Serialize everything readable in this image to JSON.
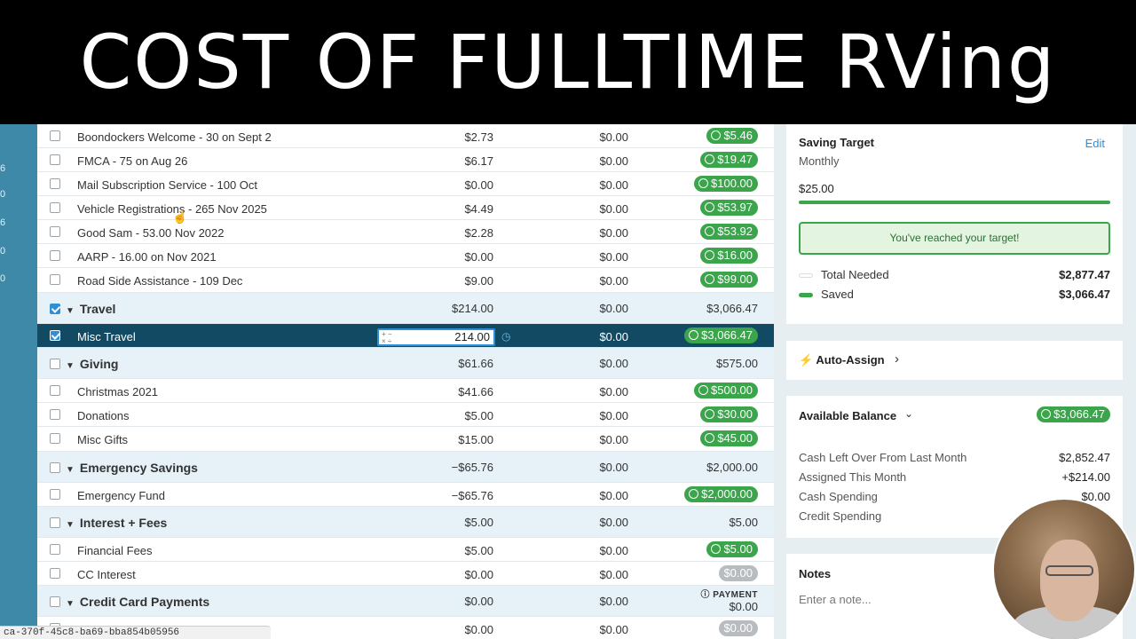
{
  "banner": {
    "title": "COST OF FULLTIME RVing"
  },
  "left_strip": [
    "6",
    "0",
    "6",
    "0",
    "0"
  ],
  "rows": [
    {
      "name": "Boondockers Welcome - 30 on Sept 2",
      "assigned": "$2.73",
      "activity": "$0.00",
      "available": "$5.46",
      "pill": "green"
    },
    {
      "name": "FMCA - 75 on Aug 26",
      "assigned": "$6.17",
      "activity": "$0.00",
      "available": "$19.47",
      "pill": "green"
    },
    {
      "name": "Mail Subscription Service - 100 Oct",
      "assigned": "$0.00",
      "activity": "$0.00",
      "available": "$100.00",
      "pill": "green"
    },
    {
      "name": "Vehicle Registrations - 265 Nov 2025",
      "assigned": "$4.49",
      "activity": "$0.00",
      "available": "$53.97",
      "pill": "green"
    },
    {
      "name": "Good Sam - 53.00 Nov 2022",
      "assigned": "$2.28",
      "activity": "$0.00",
      "available": "$53.92",
      "pill": "green"
    },
    {
      "name": "AARP - 16.00 on Nov 2021",
      "assigned": "$0.00",
      "activity": "$0.00",
      "available": "$16.00",
      "pill": "green"
    },
    {
      "name": "Road Side Assistance - 109 Dec",
      "assigned": "$9.00",
      "activity": "$0.00",
      "available": "$99.00",
      "pill": "green"
    }
  ],
  "groups": {
    "travel": {
      "name": "Travel",
      "assigned": "$214.00",
      "activity": "$0.00",
      "available": "$3,066.47"
    },
    "giving": {
      "name": "Giving",
      "assigned": "$61.66",
      "activity": "$0.00",
      "available": "$575.00"
    },
    "emergency": {
      "name": "Emergency Savings",
      "assigned": "−$65.76",
      "activity": "$0.00",
      "available": "$2,000.00"
    },
    "interest": {
      "name": "Interest + Fees",
      "assigned": "$5.00",
      "activity": "$0.00",
      "available": "$5.00"
    },
    "credit": {
      "name": "Credit Card Payments",
      "assigned": "$0.00",
      "activity": "$0.00",
      "payment_label": "PAYMENT",
      "available": "$0.00"
    }
  },
  "misc_travel": {
    "name": "Misc Travel",
    "input_value": "214.00",
    "activity": "$0.00",
    "available": "$3,066.47"
  },
  "giving_rows": [
    {
      "name": "Christmas 2021",
      "assigned": "$41.66",
      "activity": "$0.00",
      "available": "$500.00"
    },
    {
      "name": "Donations",
      "assigned": "$5.00",
      "activity": "$0.00",
      "available": "$30.00"
    },
    {
      "name": "Misc Gifts",
      "assigned": "$15.00",
      "activity": "$0.00",
      "available": "$45.00"
    }
  ],
  "emergency_rows": [
    {
      "name": "Emergency Fund",
      "assigned": "−$65.76",
      "activity": "$0.00",
      "available": "$2,000.00"
    }
  ],
  "interest_rows": [
    {
      "name": "Financial Fees",
      "assigned": "$5.00",
      "activity": "$0.00",
      "available": "$5.00"
    },
    {
      "name": "CC Interest",
      "assigned": "$0.00",
      "activity": "$0.00",
      "available": "$0.00"
    }
  ],
  "last_row": {
    "assigned": "$0.00",
    "activity": "$0.00",
    "available": "$0.00"
  },
  "saving_target": {
    "title": "Saving Target",
    "edit": "Edit",
    "frequency": "Monthly",
    "amount": "$25.00",
    "message": "You've reached your target!",
    "total_needed_label": "Total Needed",
    "total_needed": "$2,877.47",
    "saved_label": "Saved",
    "saved": "$3,066.47"
  },
  "auto_assign": {
    "label": "Auto-Assign"
  },
  "available_balance": {
    "label": "Available Balance",
    "value": "$3,066.47",
    "lines": [
      {
        "label": "Cash Left Over From Last Month",
        "value": "$2,852.47"
      },
      {
        "label": "Assigned This Month",
        "value": "+$214.00"
      },
      {
        "label": "Cash Spending",
        "value": "$0.00"
      },
      {
        "label": "Credit Spending",
        "value": ""
      }
    ]
  },
  "notes": {
    "title": "Notes",
    "placeholder": "Enter a note..."
  },
  "status_url": "ca-370f-45c8-ba69-bba854b05956",
  "colors": {
    "green": "#3aa54a",
    "selected_row": "#124a63",
    "group_row": "#e6f1f8",
    "accent": "#2f8fd6"
  }
}
